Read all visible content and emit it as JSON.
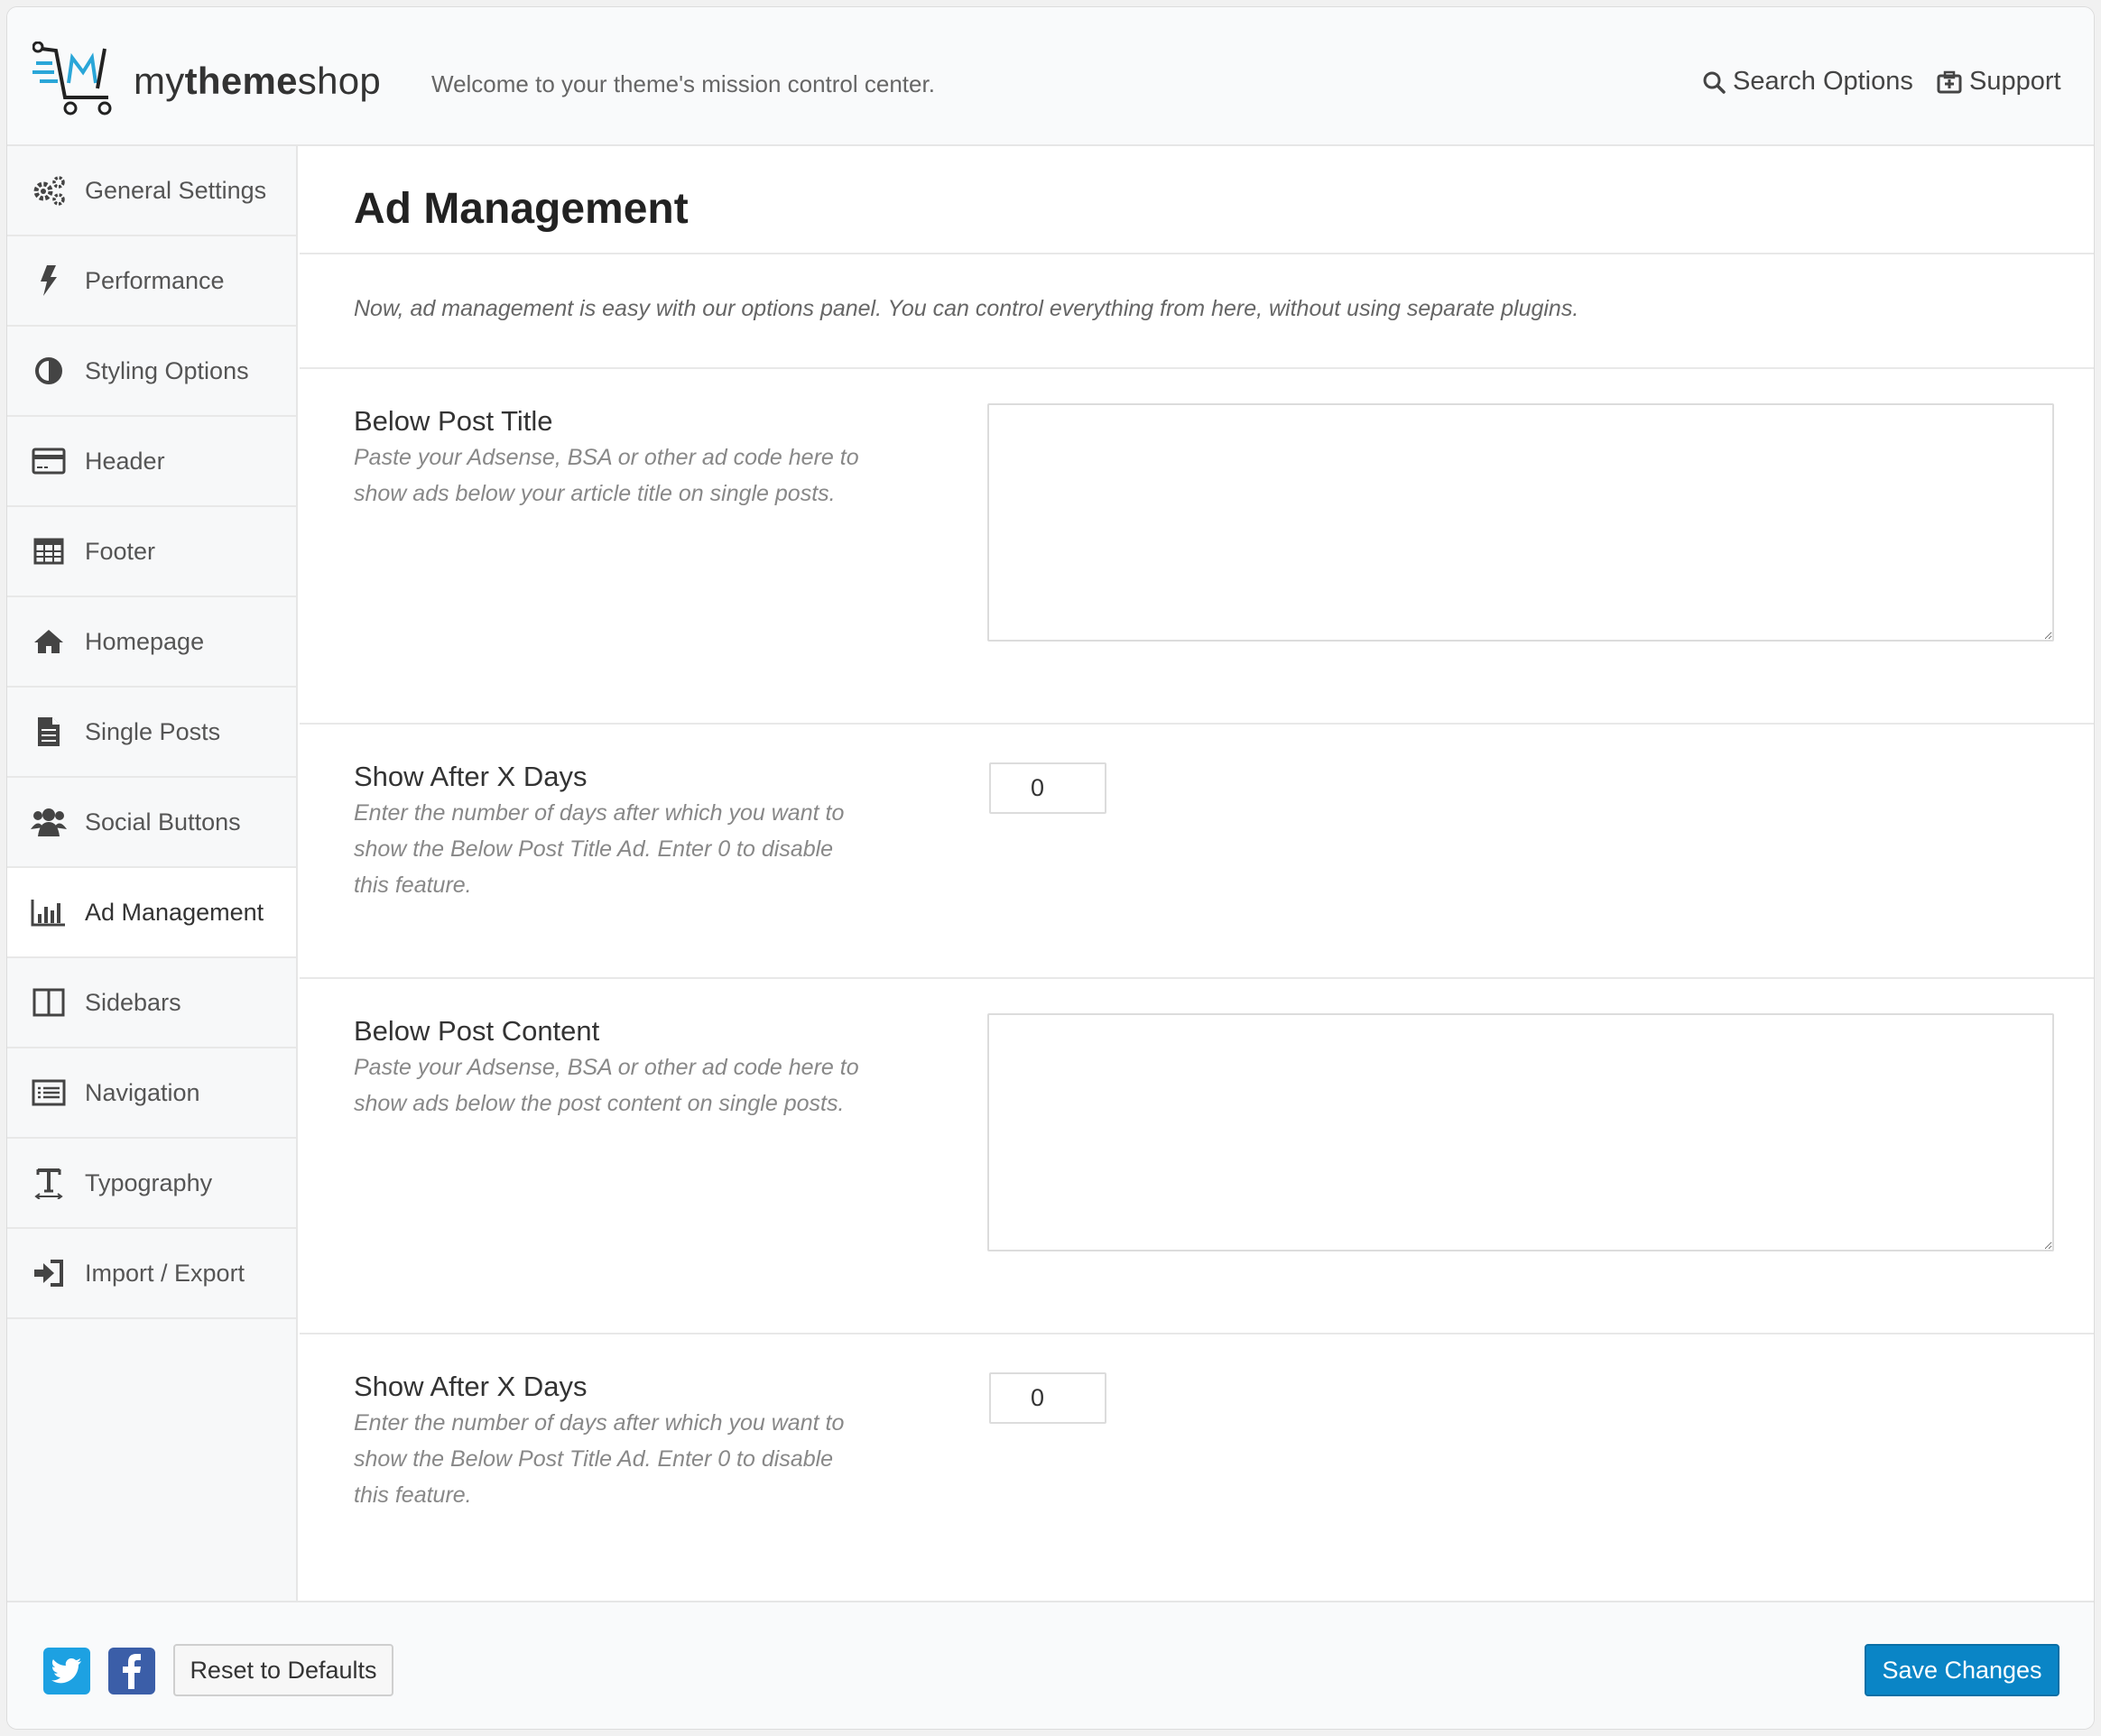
{
  "header": {
    "logo_text_light": "my",
    "logo_text_bold": "theme",
    "logo_text_end": "shop",
    "tagline": "Welcome to your theme's mission control center.",
    "search_label": "Search Options",
    "support_label": "Support"
  },
  "sidebar": {
    "items": [
      {
        "label": "General Settings",
        "icon": "gears-icon"
      },
      {
        "label": "Performance",
        "icon": "bolt-icon"
      },
      {
        "label": "Styling Options",
        "icon": "contrast-icon"
      },
      {
        "label": "Header",
        "icon": "credit-card-icon"
      },
      {
        "label": "Footer",
        "icon": "table-icon"
      },
      {
        "label": "Homepage",
        "icon": "home-icon"
      },
      {
        "label": "Single Posts",
        "icon": "document-icon"
      },
      {
        "label": "Social Buttons",
        "icon": "users-icon"
      },
      {
        "label": "Ad Management",
        "icon": "bar-chart-icon"
      },
      {
        "label": "Sidebars",
        "icon": "columns-icon"
      },
      {
        "label": "Navigation",
        "icon": "list-icon"
      },
      {
        "label": "Typography",
        "icon": "text-height-icon"
      },
      {
        "label": "Import / Export",
        "icon": "sign-in-icon"
      }
    ],
    "active": "Ad Management"
  },
  "main": {
    "title": "Ad Management",
    "intro": "Now, ad management is easy with our options panel. You can control everything from here, without using separate plugins.",
    "sections": [
      {
        "label": "Below Post Title",
        "desc_lines": [
          "Paste your Adsense, BSA or other ad code here to",
          "show ads below your article title on single posts."
        ],
        "value": ""
      },
      {
        "label": "Show After X Days",
        "desc_lines": [
          "Enter the number of days after which you want to",
          "show the Below Post Title Ad. Enter 0 to disable",
          "this feature."
        ],
        "value": "0"
      },
      {
        "label": "Below Post Content",
        "desc_lines": [
          "Paste your Adsense, BSA or other ad code here to",
          "show ads below the post content on single posts."
        ],
        "value": ""
      },
      {
        "label": "Show After X Days",
        "desc_lines": [
          "Enter the number of days after which you want to",
          "show the Below Post Title Ad. Enter 0 to disable",
          "this feature."
        ],
        "value": "0"
      }
    ]
  },
  "footer": {
    "reset_label": "Reset to Defaults",
    "save_label": "Save Changes"
  },
  "colors": {
    "accent": "#0a85c6",
    "logo_blue": "#2aa6d8",
    "twitter": "#1da1e2",
    "facebook": "#3b5ea8"
  }
}
